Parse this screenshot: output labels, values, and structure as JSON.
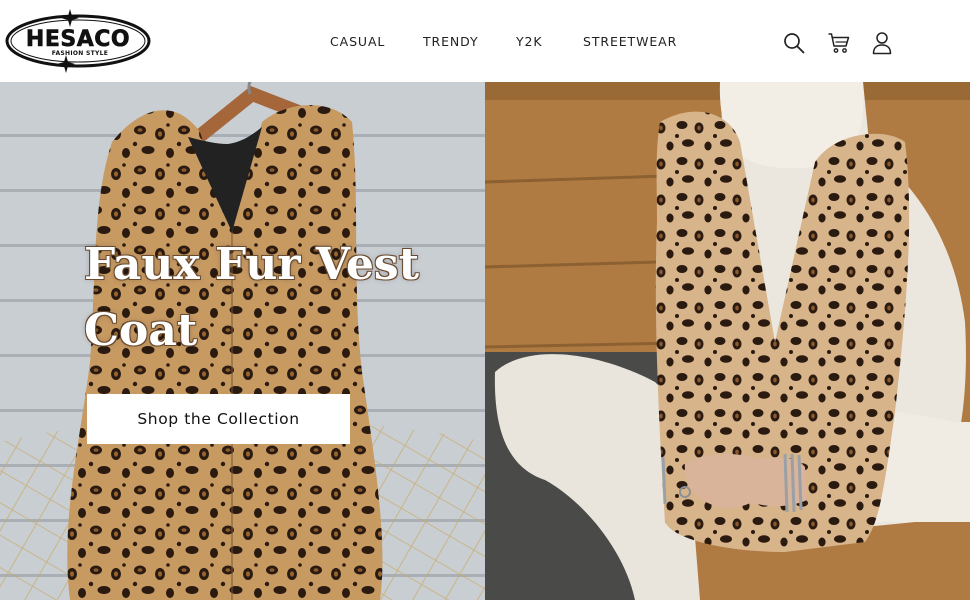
{
  "brand": {
    "name": "HESACO",
    "tagline": "FASHION STYLE"
  },
  "nav": {
    "items": [
      {
        "label": "CASUAL"
      },
      {
        "label": "TRENDY"
      },
      {
        "label": "Y2K"
      },
      {
        "label": "STREETWEAR"
      }
    ]
  },
  "header_icons": [
    "search-icon",
    "cart-icon",
    "account-icon"
  ],
  "hero": {
    "title_line1": "Faux Fur Vest",
    "title_line2": "Coat",
    "cta_label": "Shop the Collection"
  },
  "colors": {
    "accent_text": "#222222",
    "leopard_base": "#c79a62",
    "leopard_spot": "#2a1a10",
    "wood": "#a8743d",
    "sweater": "#ece7de"
  }
}
